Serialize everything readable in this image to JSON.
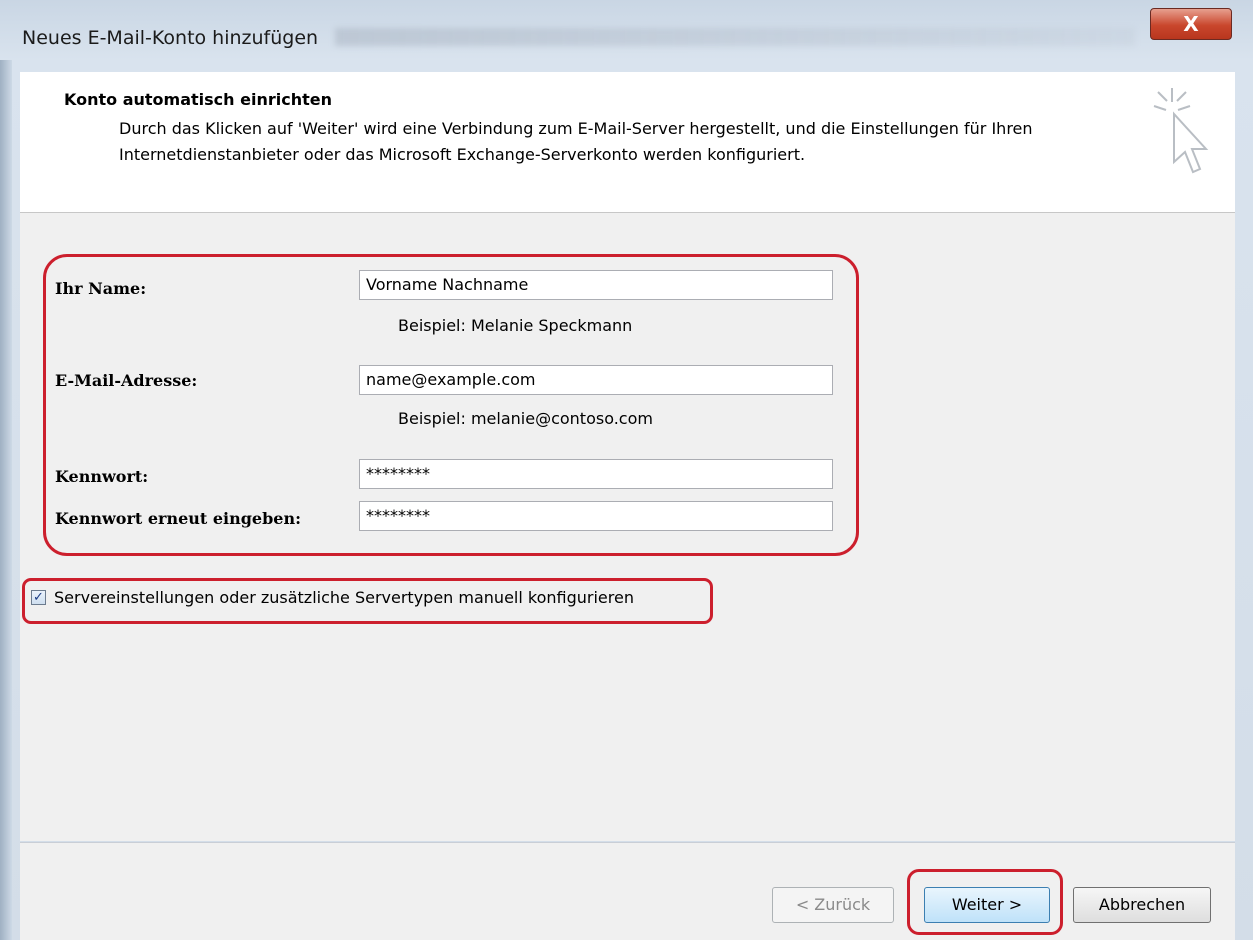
{
  "window": {
    "title": "Neues E-Mail-Konto hinzufügen",
    "close_label": "X"
  },
  "header": {
    "title": "Konto automatisch einrichten",
    "description": "Durch das Klicken auf 'Weiter' wird eine Verbindung zum E-Mail-Server hergestellt, und die Einstellungen für Ihren Internetdienstanbieter oder das Microsoft Exchange-Serverkonto werden konfiguriert.",
    "icon": "cursor-click-icon"
  },
  "form": {
    "name": {
      "label": "Ihr Name:",
      "value": "Vorname Nachname",
      "hint": "Beispiel: Melanie Speckmann"
    },
    "email": {
      "label": "E-Mail-Adresse:",
      "value": "name@example.com",
      "hint": "Beispiel: melanie@contoso.com"
    },
    "password": {
      "label": "Kennwort:",
      "value": "********"
    },
    "password_repeat": {
      "label": "Kennwort erneut eingeben:",
      "value": "********"
    }
  },
  "manual_config": {
    "label": "Servereinstellungen oder zusätzliche Servertypen manuell konfigurieren",
    "checked": true
  },
  "buttons": {
    "back": "< Zurück",
    "next": "Weiter >",
    "cancel": "Abbrechen"
  },
  "colors": {
    "highlight": "#cc1f2d",
    "close_button": "#c9462c"
  }
}
